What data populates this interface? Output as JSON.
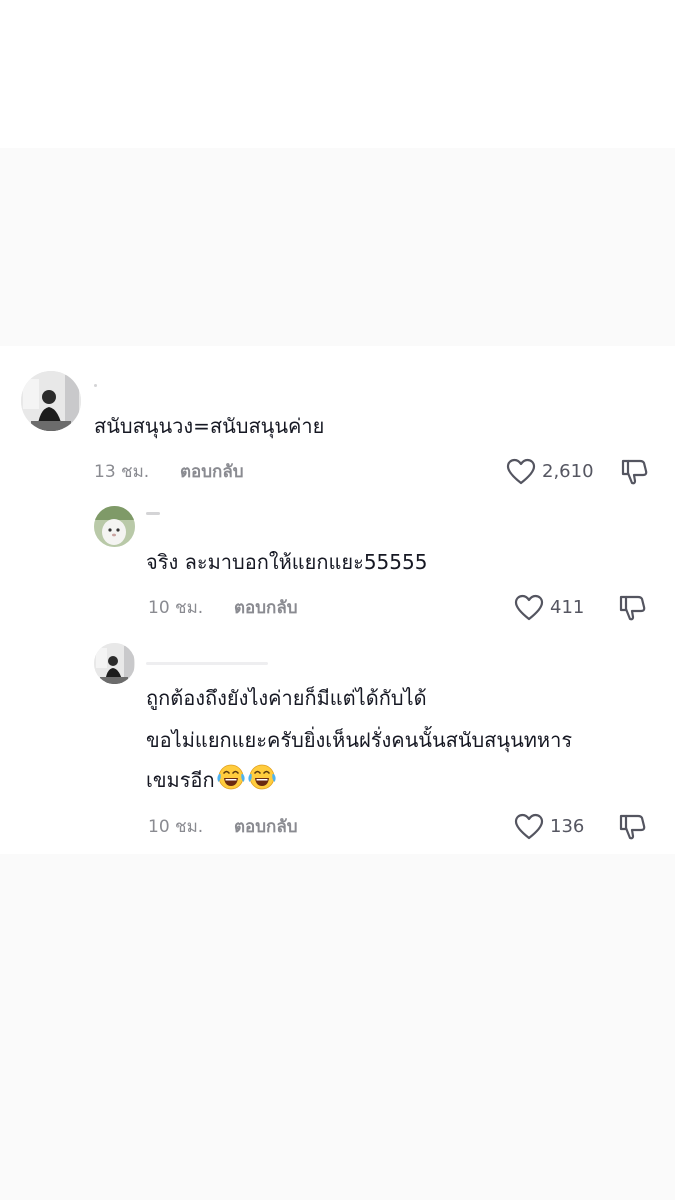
{
  "comments": [
    {
      "text": "สนับสนุนวง=สนับสนุนค่าย",
      "time": "13 ชม.",
      "reply": "ตอบกลับ",
      "likes": "2,610"
    },
    {
      "text": "จริง ละมาบอกให้แยกแยะ55555",
      "time": "10 ชม.",
      "reply": "ตอบกลับ",
      "likes": "411"
    },
    {
      "lines": [
        "ถูกต้องถึงยังไงค่ายก็มีแต่ได้กับได้",
        "ขอไม่แยกแยะครับยิ่งเห็นฝรั่งคนนั้นสนับสนุนทหาร",
        "เขมรอีก"
      ],
      "emoji": "face-with-tears-of-joy-emoji",
      "time": "10 ชม.",
      "reply": "ตอบกลับ",
      "likes": "136"
    }
  ],
  "icons": {
    "like": "heart-outline-icon",
    "dislike": "thumbs-down-outline-icon"
  },
  "colors": {
    "text": "#161823",
    "meta": "#8a8b91",
    "background_band": "#fafafa"
  }
}
